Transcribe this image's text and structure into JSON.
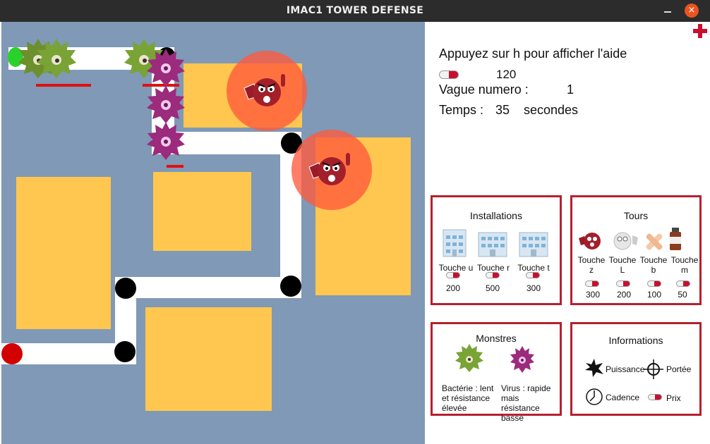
{
  "window": {
    "title": "IMAC1 TOWER DEFENSE",
    "close_label": "×"
  },
  "hud": {
    "help": "Appuyez sur h pour afficher l'aide",
    "money": "120",
    "wave_label": "Vague numero :",
    "wave_value": "1",
    "time_label": "Temps :",
    "time_value": "35",
    "time_unit": "secondes"
  },
  "installations": {
    "title": "Installations",
    "items": [
      {
        "key": "Touche u",
        "price": "200",
        "letter": "U"
      },
      {
        "key": "Touche r",
        "price": "500",
        "letter": "R"
      },
      {
        "key": "Touche t",
        "price": "300",
        "letter": "S"
      }
    ]
  },
  "tours": {
    "title": "Tours",
    "items": [
      {
        "key": "Touche z",
        "price": "300"
      },
      {
        "key": "Touche L",
        "price": "200"
      },
      {
        "key": "Touche b",
        "price": "100"
      },
      {
        "key": "Touche m",
        "price": "50"
      }
    ]
  },
  "monstres": {
    "title": "Monstres",
    "items": [
      {
        "desc": "Bactérie : lent et résistance élevée"
      },
      {
        "desc": "Virus : rapide mais résistance basse"
      }
    ]
  },
  "informations": {
    "title": "Informations",
    "items": {
      "power": "Puissance",
      "range": "Portée",
      "rate": "Cadence",
      "price": "Prix"
    }
  },
  "colors": {
    "map_bg": "#7f99b6",
    "plot": "#ffc74f",
    "border": "#b5202f",
    "tower_range": "#ff5a3c"
  }
}
